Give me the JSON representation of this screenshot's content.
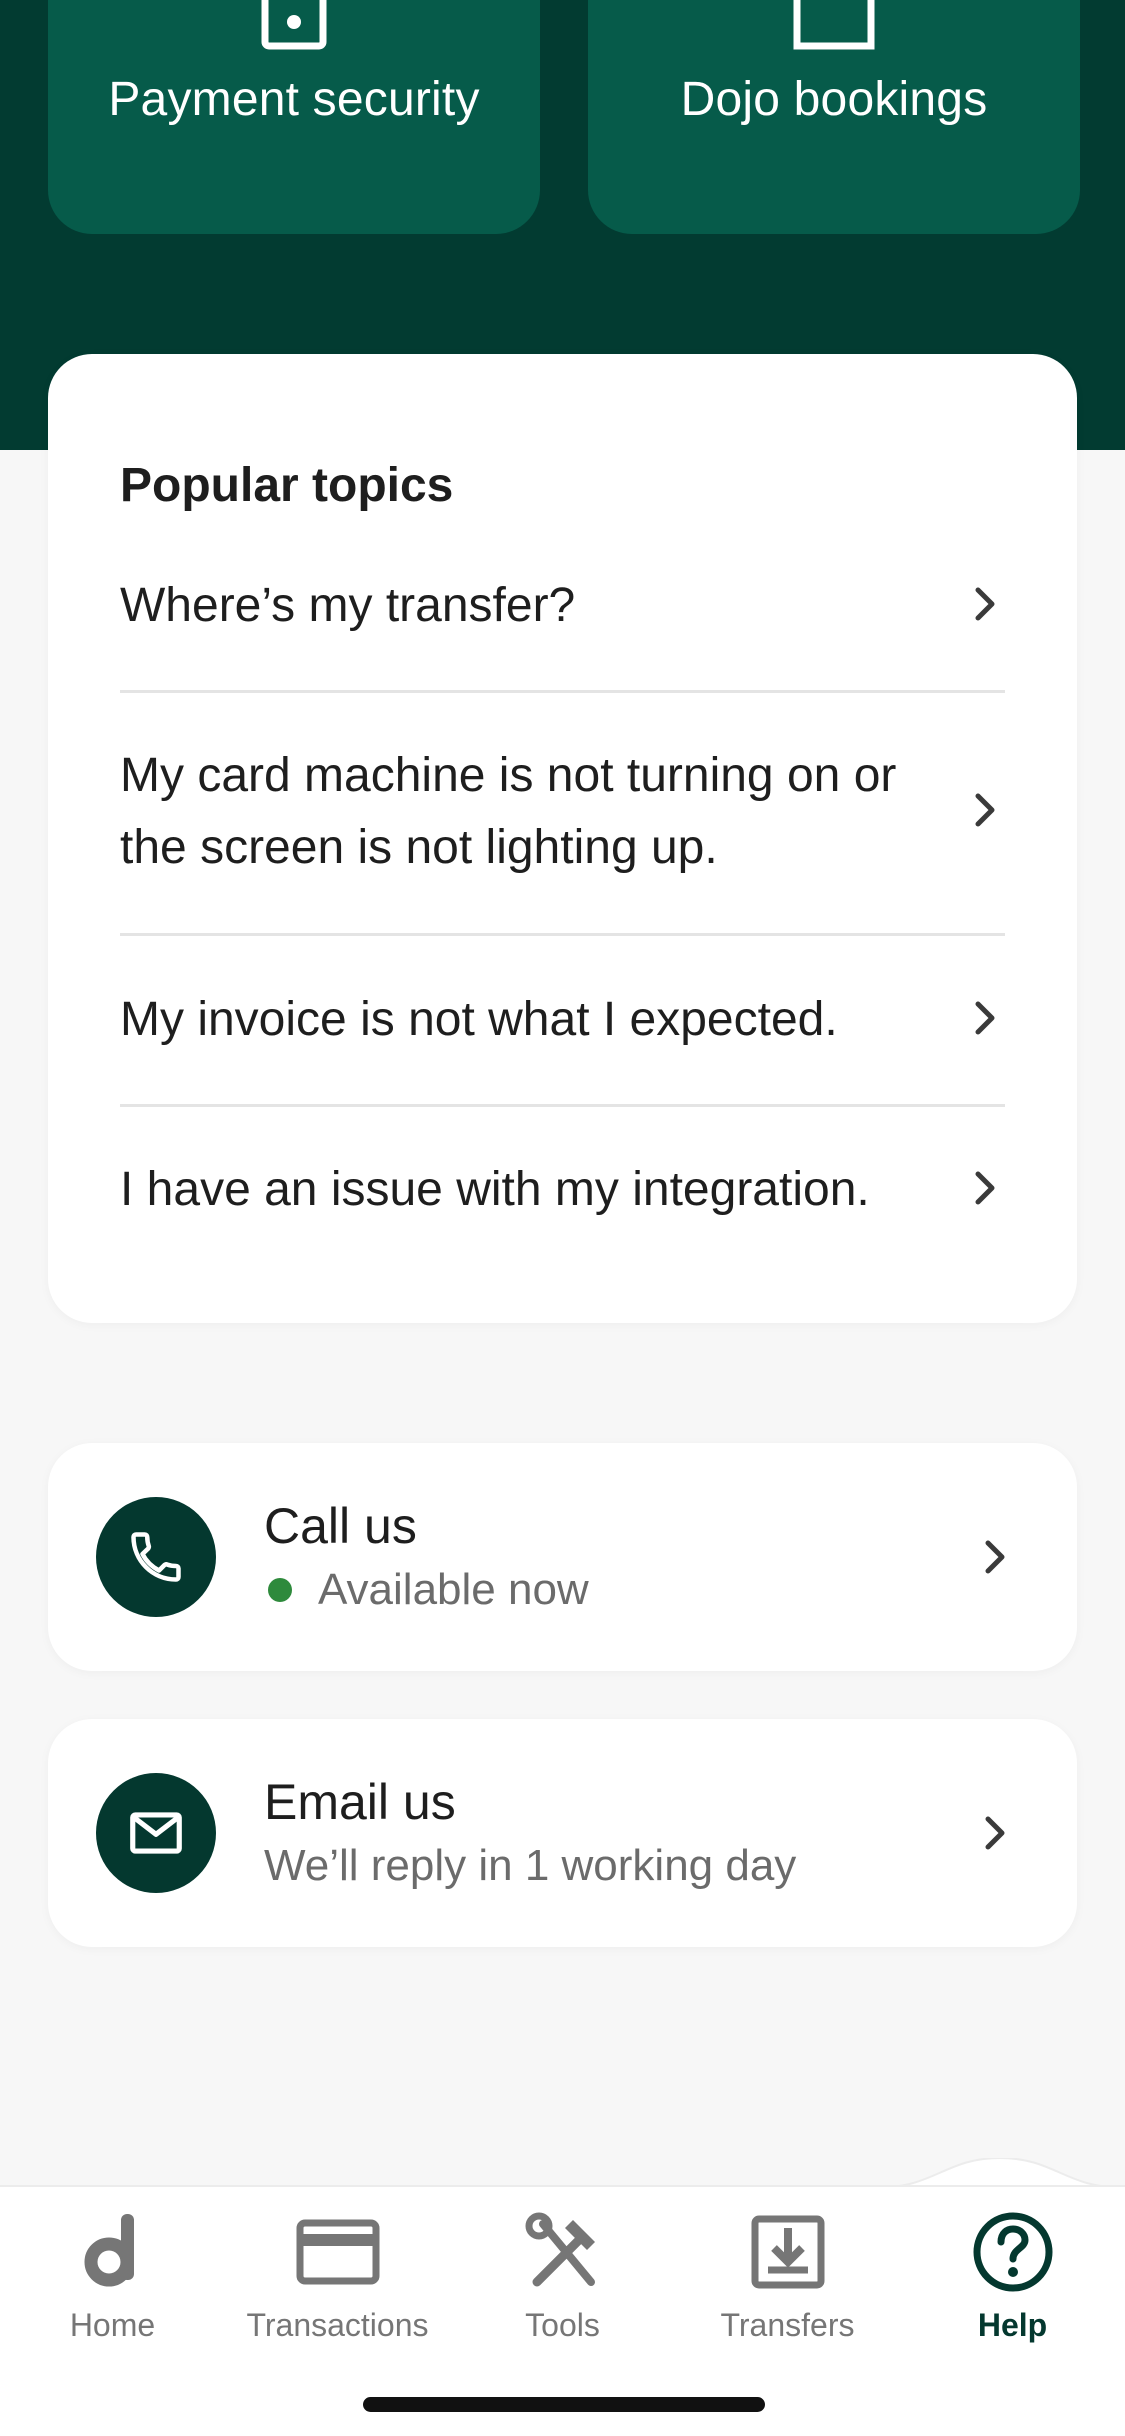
{
  "tiles": [
    {
      "label": "Payment security",
      "icon": "shield-lock-icon"
    },
    {
      "label": "Dojo bookings",
      "icon": "calendar-icon"
    }
  ],
  "popular_topics": {
    "title": "Popular topics",
    "items": [
      {
        "label": "Where’s my transfer?"
      },
      {
        "label": "My card machine is not turning on or the screen is not lighting up."
      },
      {
        "label": "My invoice is not what I expected."
      },
      {
        "label": "I have an issue with my integration."
      }
    ]
  },
  "contact": {
    "call": {
      "title": "Call us",
      "status": "Available now",
      "icon": "phone-icon",
      "status_color": "#2e8a3c"
    },
    "email": {
      "title": "Email us",
      "subtitle": "We’ll reply in 1 working day",
      "icon": "mail-icon"
    }
  },
  "tabs": [
    {
      "label": "Home",
      "icon": "dojo-logo-icon",
      "active": false
    },
    {
      "label": "Transactions",
      "icon": "card-icon",
      "active": false
    },
    {
      "label": "Tools",
      "icon": "tools-icon",
      "active": false
    },
    {
      "label": "Transfers",
      "icon": "download-tray-icon",
      "active": false
    },
    {
      "label": "Help",
      "icon": "help-circle-icon",
      "active": true
    }
  ],
  "colors": {
    "header_bg": "#023b31",
    "tile_bg": "#065b4a",
    "accent": "#04382f",
    "page_bg": "#f7f7f7"
  }
}
